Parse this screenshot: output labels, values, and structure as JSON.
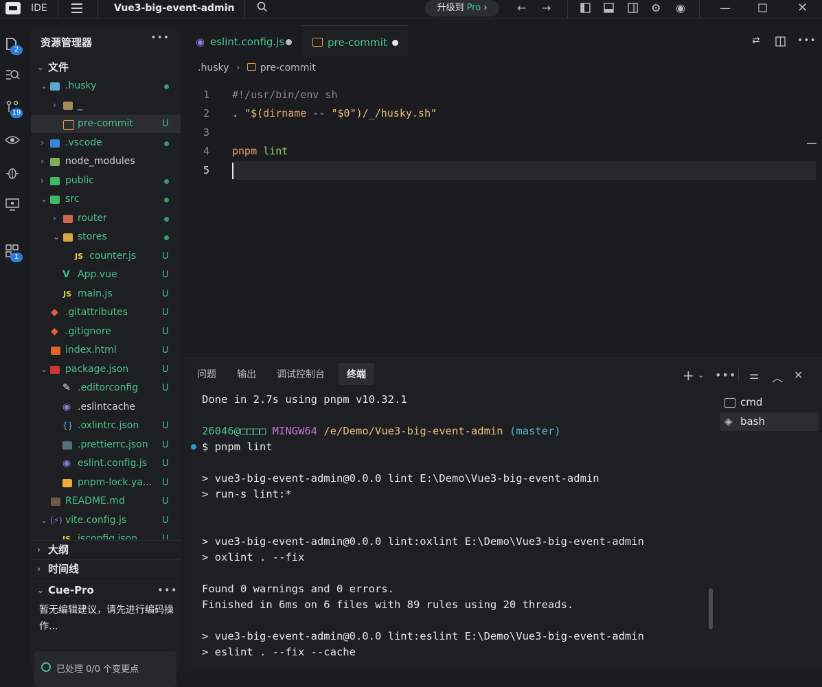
{
  "titlebar": {
    "ide_label": "IDE",
    "project_name": "Vue3-big-event-admin",
    "upgrade_prefix": "升级到",
    "upgrade_pro": "Pro",
    "upgrade_chevron": "›"
  },
  "activity": {
    "explorer_badge": "2",
    "source_control_badge": "19",
    "extensions_badge": "1"
  },
  "explorer": {
    "title": "资源管理器",
    "root_label": "文件",
    "items": [
      {
        "name": ".husky",
        "status": "dot"
      },
      {
        "name": "_",
        "status": ""
      },
      {
        "name": "pre-commit",
        "status": "U"
      },
      {
        "name": ".vscode",
        "status": "dot"
      },
      {
        "name": "node_modules",
        "status": ""
      },
      {
        "name": "public",
        "status": "dot"
      },
      {
        "name": "src",
        "status": "dot"
      },
      {
        "name": "router",
        "status": "dot"
      },
      {
        "name": "stores",
        "status": "dot"
      },
      {
        "name": "counter.js",
        "status": "U"
      },
      {
        "name": "App.vue",
        "status": "U"
      },
      {
        "name": "main.js",
        "status": "U"
      },
      {
        "name": ".gitattributes",
        "status": "U"
      },
      {
        "name": ".gitignore",
        "status": "U"
      },
      {
        "name": "index.html",
        "status": "U"
      },
      {
        "name": "package.json",
        "status": "U"
      },
      {
        "name": ".editorconfig",
        "status": "U"
      },
      {
        "name": ".eslintcache",
        "status": ""
      },
      {
        "name": ".oxlintrc.json",
        "status": "U"
      },
      {
        "name": ".prettierrc.json",
        "status": "U"
      },
      {
        "name": "eslint.config.js",
        "status": "U"
      },
      {
        "name": "pnpm-lock.ya...",
        "status": "U"
      },
      {
        "name": "README.md",
        "status": "U"
      },
      {
        "name": "vite.config.js",
        "status": "U"
      },
      {
        "name": "jsconfig.json",
        "status": "U"
      }
    ],
    "outline_label": "大纲",
    "timeline_label": "时间线",
    "cue_title": "Cue-Pro",
    "cue_message": "暂无编辑建议，请先进行编码操作...",
    "cue_status": "已处理 0/0 个变更点"
  },
  "editor": {
    "tabs": [
      {
        "label": "eslint.config.js"
      },
      {
        "label": "pre-commit"
      }
    ],
    "breadcrumb": [
      ".husky",
      "pre-commit"
    ],
    "line_numbers": [
      "1",
      "2",
      "3",
      "4",
      "5"
    ],
    "lines": [
      "#!/usr/bin/env sh",
      ". \"$(dirname -- \"$0\")/_/husky.sh\"",
      "",
      "pnpm lint",
      ""
    ]
  },
  "panel": {
    "tabs": [
      "问题",
      "输出",
      "调试控制台",
      "终端"
    ],
    "terminal_lines": [
      "Done in 2.7s using pnpm v10.32.1",
      "",
      "26046@□□□□ MINGW64 /e/Demo/Vue3-big-event-admin (master)",
      "$ pnpm lint",
      "",
      "> vue3-big-event-admin@0.0.0 lint E:\\Demo\\Vue3-big-event-admin",
      "> run-s lint:*",
      "",
      "",
      "> vue3-big-event-admin@0.0.0 lint:oxlint E:\\Demo\\Vue3-big-event-admin",
      "> oxlint . --fix",
      "",
      "Found 0 warnings and 0 errors.",
      "Finished in 6ms on 6 files with 89 rules using 20 threads.",
      "",
      "> vue3-big-event-admin@0.0.0 lint:eslint E:\\Demo\\Vue3-big-event-admin",
      "> eslint . --fix --cache"
    ],
    "prompt_user": "26046@□□□□",
    "prompt_env": "MINGW64",
    "prompt_path": "/e/Demo/Vue3-big-event-admin",
    "prompt_branch": "(master)",
    "terminals": [
      {
        "label": "cmd"
      },
      {
        "label": "bash"
      }
    ]
  },
  "colors": {
    "accent_green": "#4cc38a",
    "badge_blue": "#2b7fd6",
    "prompt_green": "#4cc38a",
    "prompt_magenta": "#c970d8",
    "prompt_yellow": "#e5c07b",
    "prompt_cyan": "#56b6c2"
  }
}
